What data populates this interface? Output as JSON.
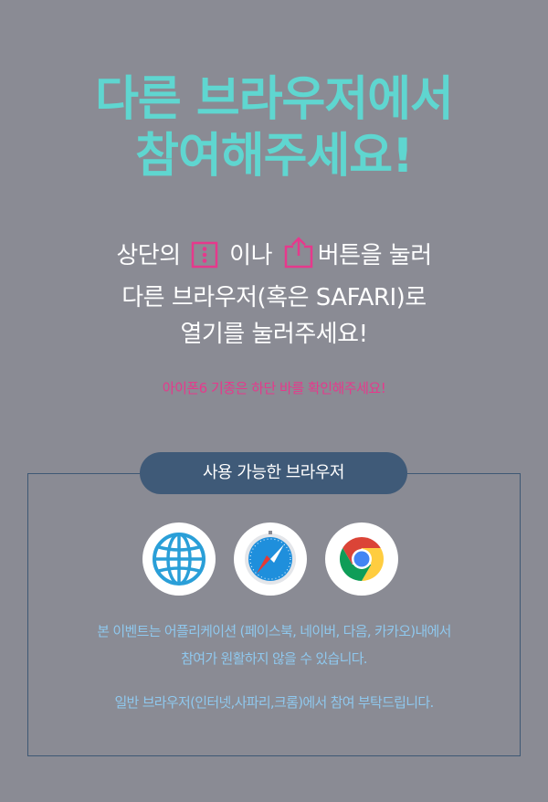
{
  "title": {
    "line1": "다른 브라우저에서",
    "line2": "참여해주세요!"
  },
  "instructions": {
    "line1_a": "상단의",
    "line1_b": "이나",
    "line1_c": "버튼을 눌러",
    "line2": "다른 브라우저(혹은 SAFARI)로",
    "line3": "열기를 눌러주세요!"
  },
  "note": "아이폰6 기종은 하단 바를 확인해주세요!",
  "available_browsers": {
    "label": "사용 가능한 브라우저",
    "icons": [
      "globe-icon",
      "safari-icon",
      "chrome-icon"
    ]
  },
  "description": {
    "line1": "본 이벤트는 어플리케이션 (페이스북, 네이버, 다음, 카카오)내에서",
    "line2": "참여가 원활하지 않을 수 있습니다.",
    "line3": "일반 브라우저(인터넷,사파리,크롬)에서 참여 부탁드립니다."
  },
  "colors": {
    "background": "#8a8b94",
    "title": "#5fd6d0",
    "accent_pink": "#e6398c",
    "badge": "#3f5a78",
    "description": "#8fc8ee"
  }
}
